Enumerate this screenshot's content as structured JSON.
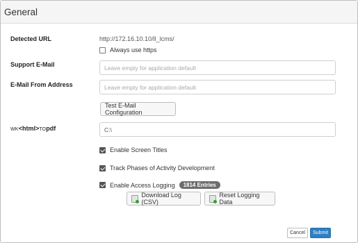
{
  "panel": {
    "title": "General"
  },
  "detected_url": {
    "label": "Detected URL",
    "value": "http://172.16.10.10/ll_lcms/",
    "always_https_label": "Always use https",
    "always_https_checked": false
  },
  "support_email": {
    "label": "Support E-Mail",
    "placeholder": "Leave empty for application default",
    "value": ""
  },
  "email_from": {
    "label": "E-Mail From Address",
    "placeholder": "Leave empty for application default",
    "value": ""
  },
  "test_email_button": "Test E-Mail Configuration",
  "wkhtmltopdf": {
    "label_prefix": "WK",
    "label_tag": "<html>",
    "label_mid": "TO",
    "label_suffix": "pdf",
    "value": "C:\\"
  },
  "options": [
    {
      "label": "Enable Screen Titles",
      "checked": true
    },
    {
      "label": "Track Phases of Activity Development",
      "checked": true
    },
    {
      "label": "Enable Access Logging",
      "checked": true
    }
  ],
  "logging_badge": "1814 Entries",
  "download_log_button": "Download Log (CSV)",
  "reset_logging_button": "Reset Logging Data",
  "footer": {
    "cancel": "Cancel",
    "submit": "Submit"
  },
  "colors": {
    "submit_blue": "#2f7fc2",
    "badge_gray": "#6c6c6c"
  },
  "icons": {
    "download_log": "spreadsheet-icon",
    "reset_logging": "spreadsheet-icon"
  }
}
